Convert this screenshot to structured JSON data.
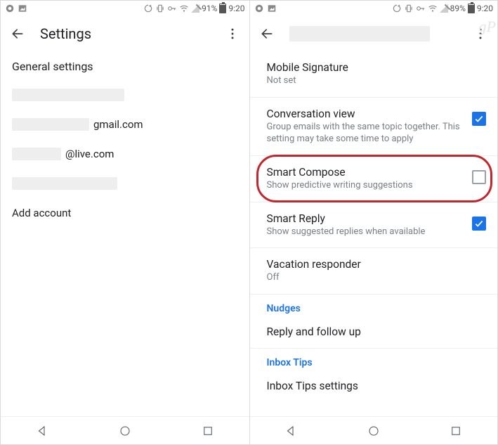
{
  "left": {
    "status": {
      "battery_pct": "91%",
      "clock": "9:20"
    },
    "appbar": {
      "title": "Settings"
    },
    "section_header": "General settings",
    "accounts": [
      {
        "prefix_redacted": true,
        "suffix": ""
      },
      {
        "prefix_redacted": true,
        "suffix": "gmail.com"
      },
      {
        "prefix_redacted": true,
        "suffix": "@live.com"
      },
      {
        "prefix_redacted": true,
        "suffix": ""
      }
    ],
    "add_account": "Add account"
  },
  "right": {
    "status": {
      "battery_pct": "89%",
      "clock": "9:20"
    },
    "settings": [
      {
        "key": "mobile_signature",
        "label": "Mobile Signature",
        "sub": "Not set",
        "checkbox": null
      },
      {
        "key": "conversation_view",
        "label": "Conversation view",
        "sub": "Group emails with the same topic together. This setting may take some time to apply",
        "checkbox": true
      },
      {
        "key": "smart_compose",
        "label": "Smart Compose",
        "sub": "Show predictive writing suggestions",
        "checkbox": false,
        "highlighted": true
      },
      {
        "key": "smart_reply",
        "label": "Smart Reply",
        "sub": "Show suggested replies when available",
        "checkbox": true
      },
      {
        "key": "vacation_responder",
        "label": "Vacation responder",
        "sub": "Off",
        "checkbox": null
      }
    ],
    "nudges_header": "Nudges",
    "nudges_row": "Reply and follow up",
    "inbox_tips_header": "Inbox Tips",
    "inbox_tips_row": "Inbox Tips settings",
    "watermark": "gP"
  }
}
